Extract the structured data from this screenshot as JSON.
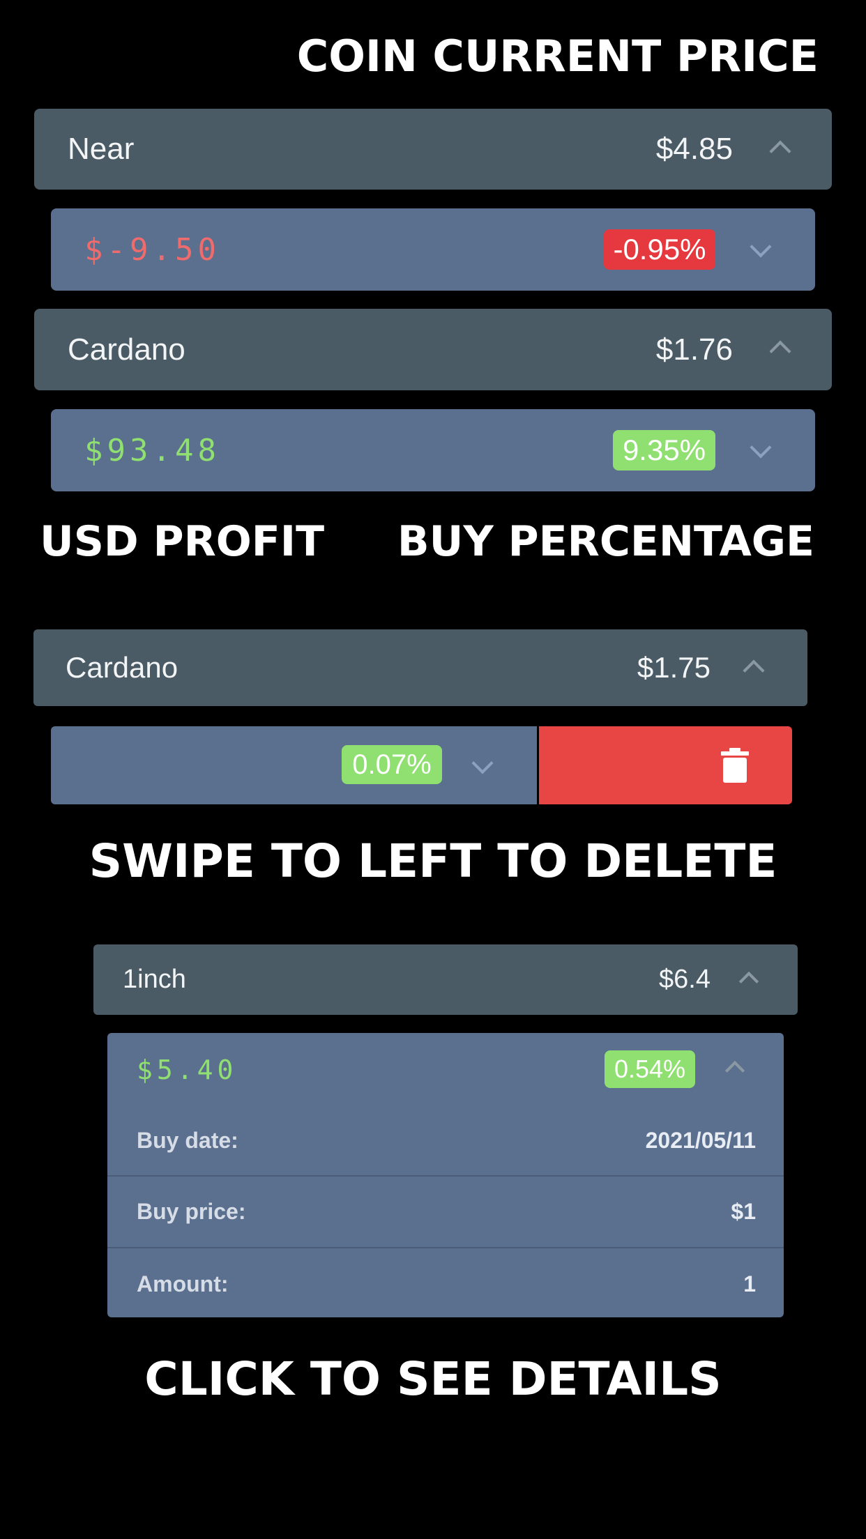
{
  "captions": {
    "coin_current_price": "COIN CURRENT PRICE",
    "usd_profit": "USD PROFIT",
    "buy_percentage": "BUY PERCENTAGE",
    "swipe_to_delete": "SWIPE TO LEFT TO DELETE",
    "click_to_see_details": "CLICK TO SEE DETAILS"
  },
  "section1": {
    "coins": [
      {
        "name": "Near",
        "price": "$4.85",
        "profit": "$-9.50",
        "percent": "-0.95%",
        "trend": "down"
      },
      {
        "name": "Cardano",
        "price": "$1.76",
        "profit": "$93.48",
        "percent": "9.35%",
        "trend": "up"
      }
    ]
  },
  "section2": {
    "coin": {
      "name": "Cardano",
      "price": "$1.75",
      "percent": "0.07%"
    },
    "delete_icon": "trash-icon"
  },
  "section3": {
    "coin": {
      "name": "1inch",
      "price": "$6.4",
      "profit": "$5.40",
      "percent": "0.54%"
    },
    "details": [
      {
        "label": "Buy date:",
        "value": "2021/05/11"
      },
      {
        "label": "Buy price:",
        "value": "$1"
      },
      {
        "label": "Amount:",
        "value": "1"
      }
    ]
  },
  "colors": {
    "coin_row": "#4b5b66",
    "detail_row": "#5b6f8e",
    "loss": "#f06b6b",
    "gain": "#8fe070",
    "delete": "#e84545"
  }
}
